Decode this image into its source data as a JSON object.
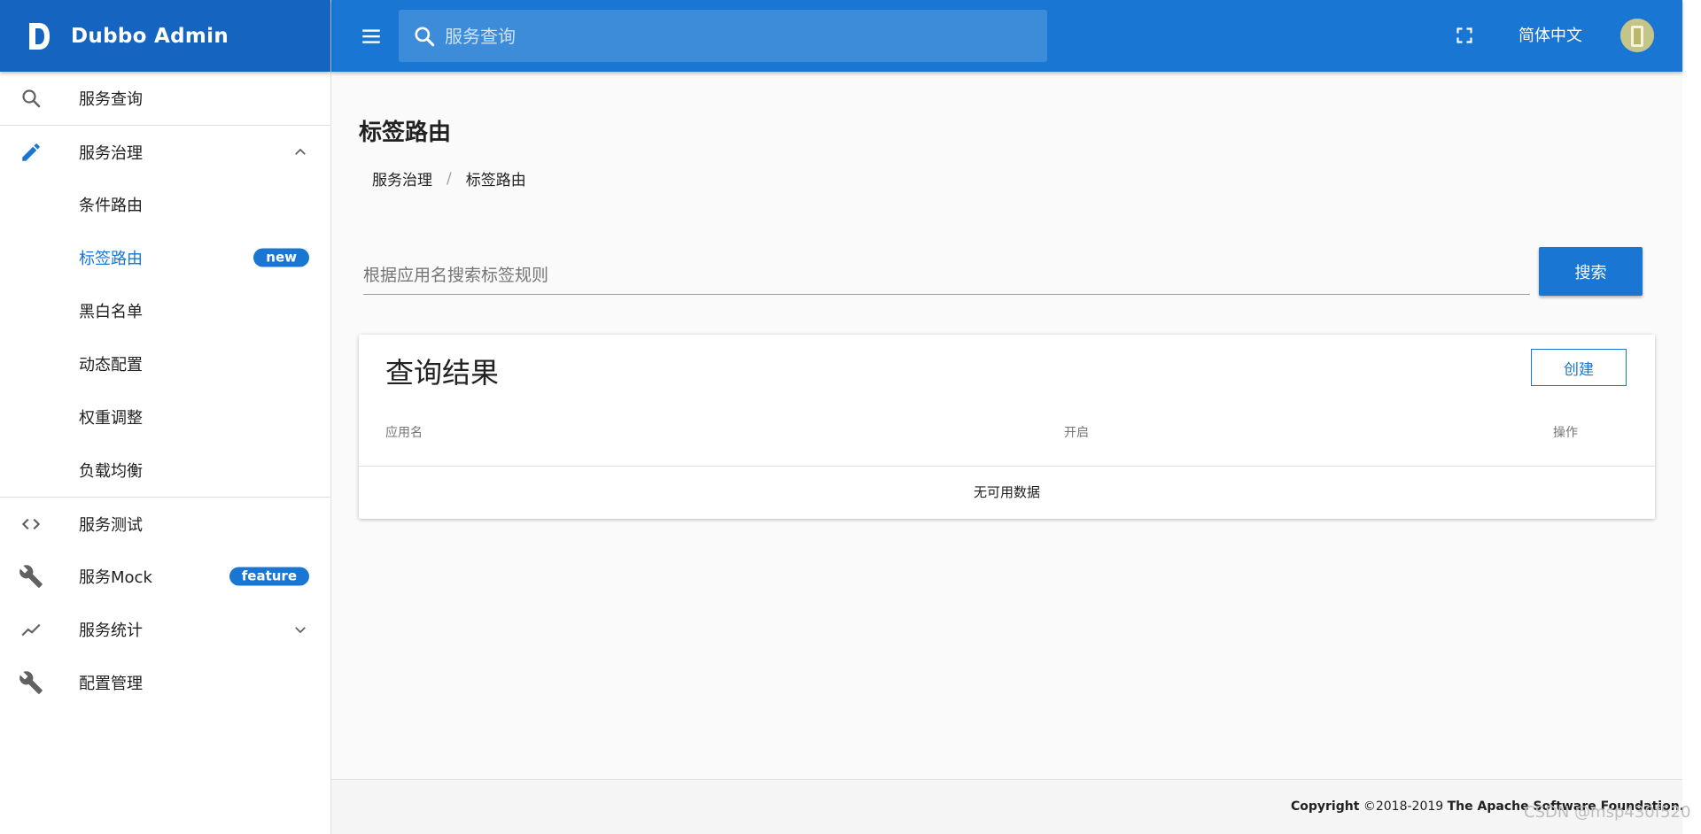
{
  "brand": {
    "title": "Dubbo Admin"
  },
  "sidebar": {
    "items": [
      {
        "label": "服务查询",
        "icon": "search-icon"
      },
      {
        "label": "服务治理",
        "icon": "pencil-icon"
      },
      {
        "label": "条件路由"
      },
      {
        "label": "标签路由",
        "badge": "new"
      },
      {
        "label": "黑白名单"
      },
      {
        "label": "动态配置"
      },
      {
        "label": "权重调整"
      },
      {
        "label": "负载均衡"
      },
      {
        "label": "服务测试",
        "icon": "code-icon"
      },
      {
        "label": "服务Mock",
        "icon": "wrench-icon",
        "badge": "feature"
      },
      {
        "label": "服务统计",
        "icon": "trending-icon"
      },
      {
        "label": "配置管理",
        "icon": "wrench-icon"
      }
    ]
  },
  "header": {
    "search_placeholder": "服务查询",
    "language": "简体中文"
  },
  "page": {
    "title": "标签路由",
    "breadcrumb": [
      "服务治理",
      "标签路由"
    ],
    "search_placeholder": "根据应用名搜索标签规则",
    "search_button": "搜索"
  },
  "results": {
    "title": "查询结果",
    "create_button": "创建",
    "columns": [
      "应用名",
      "开启",
      "操作"
    ],
    "empty_text": "无可用数据"
  },
  "footer": {
    "copyright_label": "Copyright",
    "years": "©2018-2019",
    "org": "The Apache Software Foundation."
  },
  "watermark": "CSDN @msp430f520",
  "colors": {
    "brand": "#1565c0",
    "primary": "#1976d2",
    "background": "#fafafa"
  }
}
